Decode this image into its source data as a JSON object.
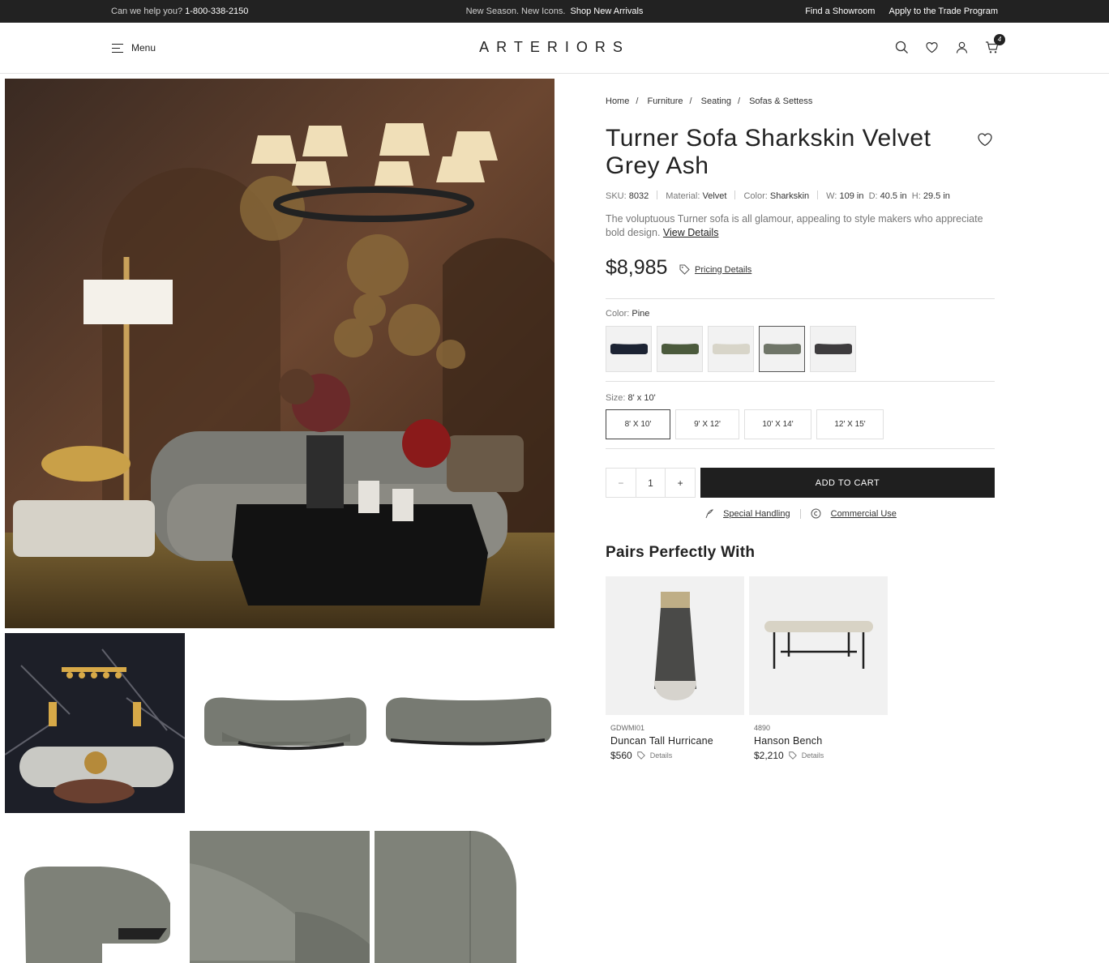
{
  "topbar": {
    "help_text": "Can we help you?",
    "phone": "1-800-338-2150",
    "promo_text": "New Season. New Icons.",
    "promo_link": "Shop New Arrivals",
    "showroom_link": "Find a Showroom",
    "trade_link": "Apply to the Trade Program"
  },
  "header": {
    "menu_label": "Menu",
    "logo": "ARTERIORS",
    "cart_count": "4",
    "icons": [
      "search-icon",
      "heart-icon",
      "user-icon",
      "cart-icon"
    ]
  },
  "breadcrumb": [
    "Home",
    "Furniture",
    "Seating",
    "Sofas & Settess"
  ],
  "product": {
    "title": "Turner Sofa Sharkskin Velvet Grey Ash",
    "sku_label": "SKU:",
    "sku": "8032",
    "material_label": "Material:",
    "material": "Velvet",
    "color_label": "Color:",
    "color": "Sharkskin",
    "w_label": "W:",
    "w": "109 in",
    "d_label": "D:",
    "d": "40.5 in",
    "h_label": "H:",
    "h": "29.5 in",
    "description": "The voluptuous Turner sofa is all glamour, appealing to style makers who appreciate bold design.",
    "view_details": "View Details",
    "price": "$8,985",
    "pricing_details": "Pricing Details"
  },
  "color_option": {
    "label": "Color:",
    "selected": "Pine",
    "swatches": [
      {
        "color": "#1c2333"
      },
      {
        "color": "#4b5a3c"
      },
      {
        "color": "#d8d5c9"
      },
      {
        "color": "#6f7568"
      },
      {
        "color": "#3e3c3e"
      }
    ],
    "selected_index": 3
  },
  "size_option": {
    "label": "Size:",
    "selected": "8' x 10'",
    "options": [
      "8' X 10'",
      "9' X 12'",
      "10' X 14'",
      "12' X 15'"
    ],
    "selected_index": 0
  },
  "cart": {
    "qty_minus": "−",
    "quantity": "1",
    "qty_plus": "+",
    "add_to_cart": "ADD TO CART"
  },
  "service_links": {
    "special_handling": "Special Handling",
    "commercial_use": "Commercial Use"
  },
  "pairs": {
    "title": "Pairs Perfectly With",
    "items": [
      {
        "sku": "GDWMI01",
        "name": "Duncan Tall Hurricane",
        "price": "$560",
        "details": "Details"
      },
      {
        "sku": "4890",
        "name": "Hanson Bench",
        "price": "$2,210",
        "details": "Details"
      }
    ]
  },
  "colors": {
    "topbar_bg": "#222222",
    "button_bg": "#1f1f1f",
    "hero_wall": "#5a3a28"
  }
}
